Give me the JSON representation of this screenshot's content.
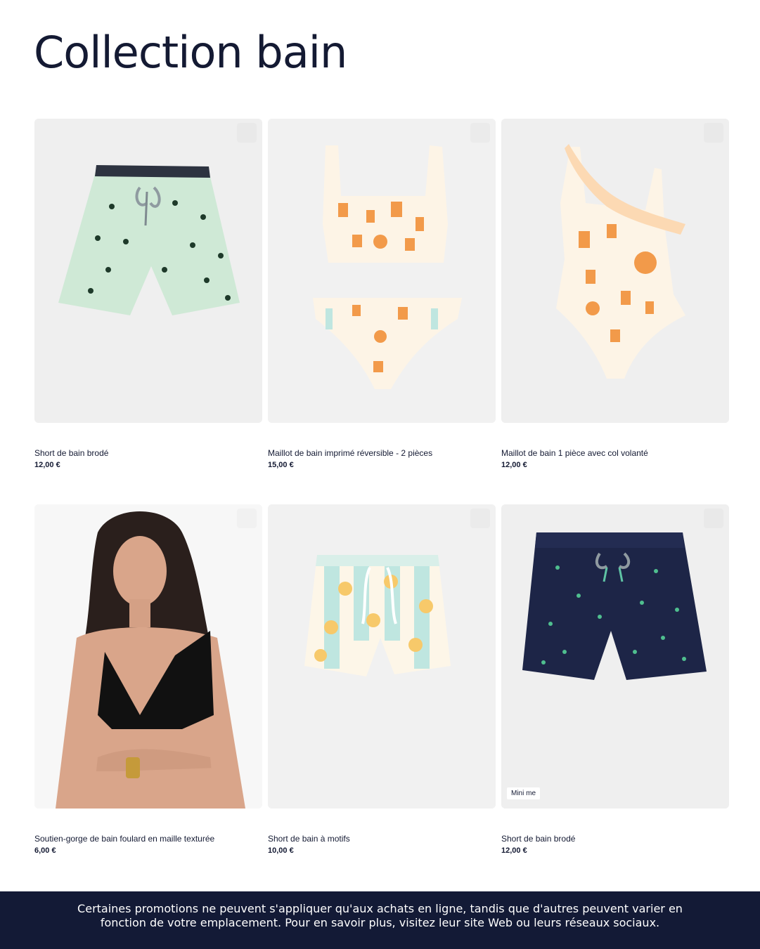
{
  "page": {
    "title": "Collection bain"
  },
  "products": [
    {
      "name": "Short de bain brodé",
      "price": "12,00 €",
      "image": "mint-swim-shorts-palm-print"
    },
    {
      "name": "Maillot de bain imprimé réversible - 2 pièces",
      "price": "15,00 €",
      "image": "printed-bikini-two-piece"
    },
    {
      "name": "Maillot de bain 1 pièce avec col volanté",
      "price": "12,00 €",
      "image": "ruffle-one-piece-swimsuit"
    },
    {
      "name": "Soutien-gorge de bain foulard en maille texturée",
      "price": "6,00 €",
      "image": "model-black-bikini-top"
    },
    {
      "name": "Short de bain à motifs",
      "price": "10,00 €",
      "image": "striped-sun-swim-shorts"
    },
    {
      "name": "Short de bain brodé",
      "price": "12,00 €",
      "image": "navy-swim-shorts-palm-print",
      "badge": "Mini me"
    }
  ],
  "footer": {
    "text": "Certaines promotions ne peuvent s'appliquer qu'aux achats en ligne, tandis que d'autres peuvent varier en fonction de votre emplacement. Pour en savoir plus, visitez leur site Web ou leurs réseaux sociaux."
  },
  "colors": {
    "navy": "#131a36",
    "mint": "#cfe9d6",
    "orange": "#f29a4a",
    "aqua": "#bfe6e0"
  }
}
